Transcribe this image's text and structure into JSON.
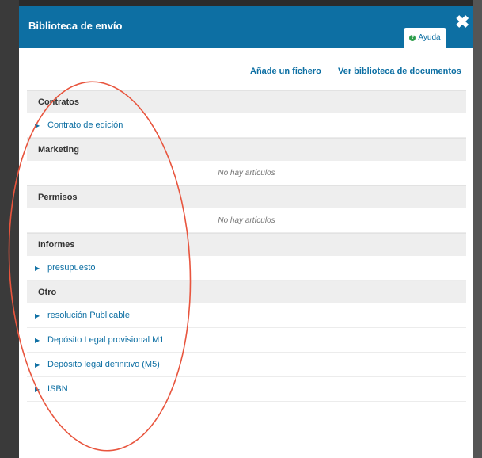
{
  "modal": {
    "title": "Biblioteca de envío",
    "help_label": "Ayuda",
    "close_glyph": "✖"
  },
  "toolbar": {
    "add_file_label": "Añade un fichero",
    "view_library_label": "Ver biblioteca de documentos"
  },
  "sections": [
    {
      "title": "Contratos",
      "items": [
        "Contrato de edición"
      ]
    },
    {
      "title": "Marketing",
      "empty_text": "No hay artículos"
    },
    {
      "title": "Permisos",
      "empty_text": "No hay artículos"
    },
    {
      "title": "Informes",
      "items": [
        "presupuesto"
      ]
    },
    {
      "title": "Otro",
      "items": [
        "resolución Publicable",
        "Depósito Legal provisional M1",
        "Depósito legal definitivo (M5)",
        "ISBN"
      ]
    }
  ],
  "colors": {
    "header": "#0d6fa3",
    "link": "#0d6fa3",
    "annotation": "#e8553e"
  },
  "icons": {
    "close": "close-icon",
    "help": "help-icon",
    "row_arrow": "triangle-right-icon"
  }
}
